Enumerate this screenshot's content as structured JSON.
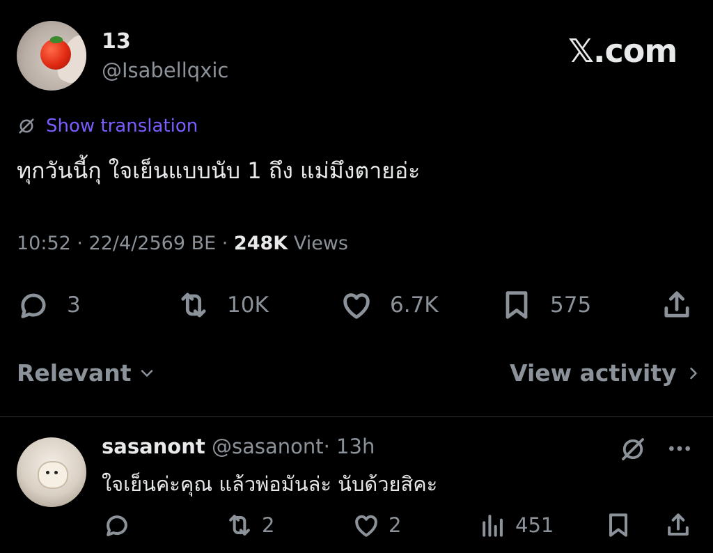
{
  "post": {
    "author_name": "13",
    "author_handle": "@Isabellqxic",
    "brand": "𝕏.com",
    "translation_link": "Show translation",
    "text": "ทุกวันนี้กุ ใจเย็นแบบนับ 1 ถึง แม่มึงตายอ่ะ",
    "time": "10:52 · 22/4/2569 BE ·",
    "views_count": "248K",
    "views_label": "Views",
    "replies": "3",
    "reposts": "10K",
    "likes": "6.7K",
    "bookmarks": "575"
  },
  "filters": {
    "sort_label": "Relevant",
    "view_activity_label": "View activity"
  },
  "reply": {
    "name": "sasanont",
    "handle": "@sasanont",
    "time": "· 13h",
    "text": "ใจเย็นค่ะคุณ แล้วพ่อมันล่ะ นับด้วยสิคะ",
    "replies": "",
    "reposts": "2",
    "likes": "2",
    "views": "451"
  },
  "colors": {
    "background": "#000000",
    "text": "#e7e9ea",
    "secondary": "#8b9299",
    "link": "#7b5cff",
    "divider": "#2f3336"
  }
}
